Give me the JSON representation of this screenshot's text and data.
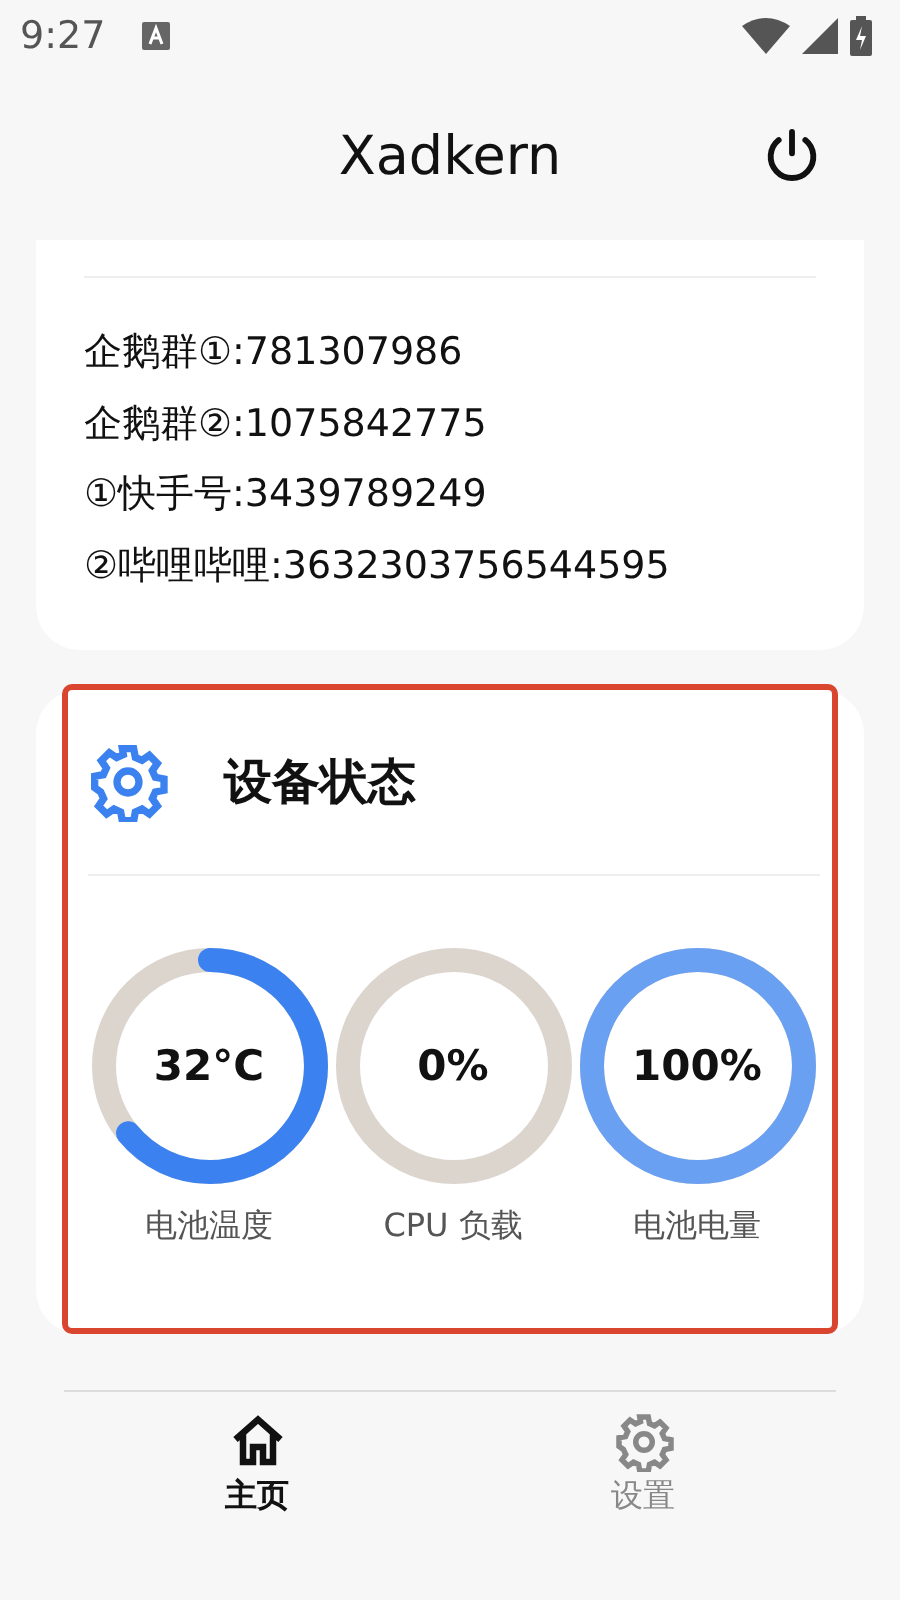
{
  "status_bar": {
    "time": "9:27"
  },
  "header": {
    "title": "Xadkern"
  },
  "contacts": [
    "企鹅群①:781307986",
    "企鹅群②:1075842775",
    "①快手号:3439789249",
    "②哔哩哔哩:3632303756544595"
  ],
  "device_status": {
    "title": "设备状态",
    "highlighted": true,
    "gauges": [
      {
        "value": "32°C",
        "label": "电池温度",
        "level": 0.64
      },
      {
        "value": "0%",
        "label": "CPU 负载"
      },
      {
        "value": "100%",
        "label": "电池电量",
        "level": 1
      }
    ]
  },
  "bottom_nav": [
    {
      "label": "主页",
      "kind": "home",
      "selected": true
    },
    {
      "label": "设置",
      "kind": "settings",
      "selected": false
    }
  ]
}
